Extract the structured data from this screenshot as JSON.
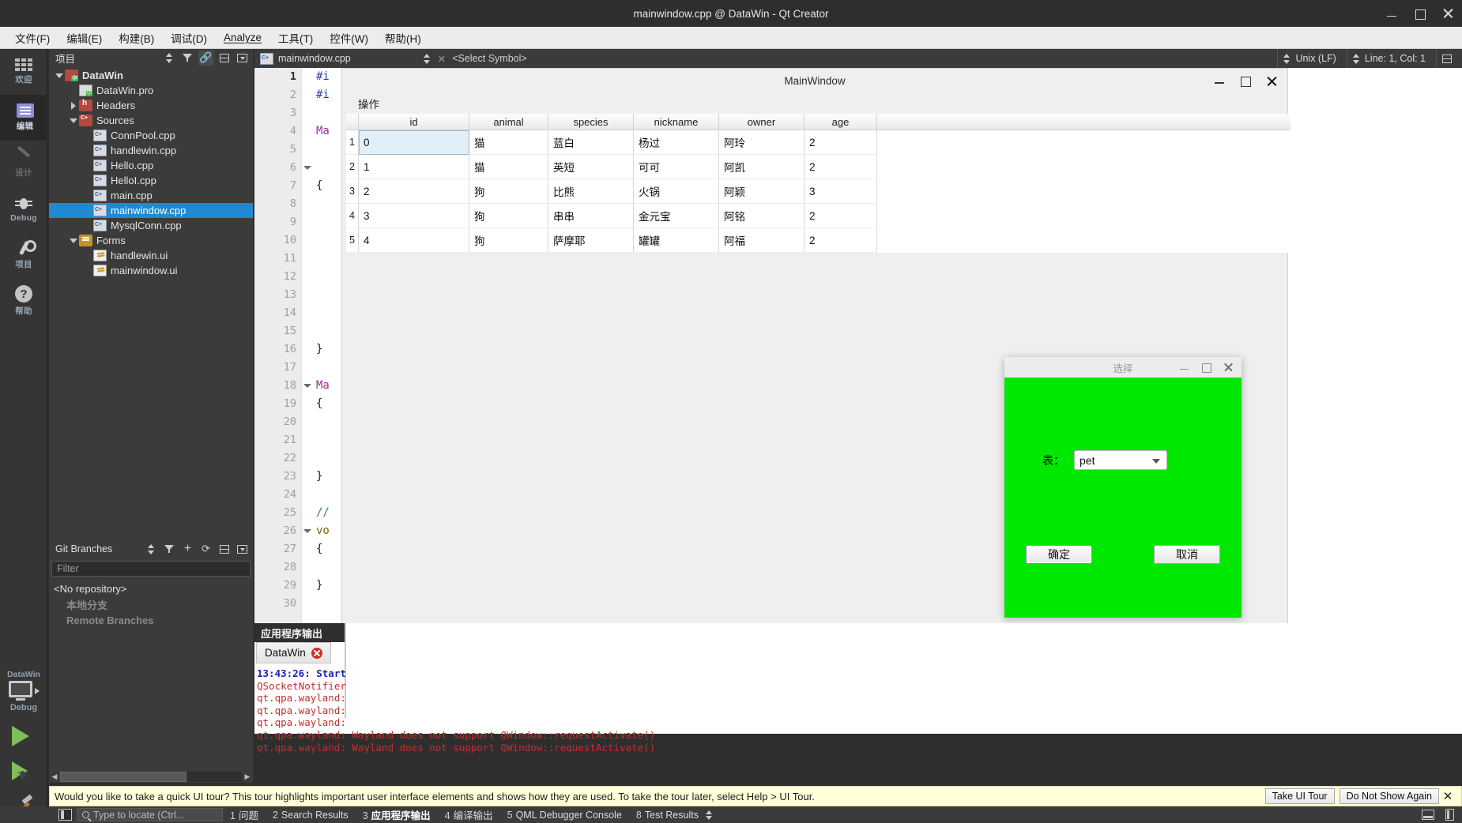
{
  "window": {
    "title": "mainwindow.cpp @ DataWin - Qt Creator",
    "controls": {
      "minimize": "—",
      "maximize": "□",
      "close": "✕"
    }
  },
  "menubar": {
    "items": [
      {
        "label": "文件(F)"
      },
      {
        "label": "编辑(E)"
      },
      {
        "label": "构建(B)"
      },
      {
        "label": "调试(D)"
      },
      {
        "label": "Analyze"
      },
      {
        "label": "工具(T)"
      },
      {
        "label": "控件(W)"
      },
      {
        "label": "帮助(H)"
      }
    ]
  },
  "modebar": {
    "items": [
      {
        "label": "欢迎",
        "icon": "grid-icon"
      },
      {
        "label": "编辑",
        "icon": "edit-icon"
      },
      {
        "label": "设计",
        "icon": "pen-icon"
      },
      {
        "label": "Debug",
        "icon": "bug-icon"
      },
      {
        "label": "项目",
        "icon": "wrench-icon"
      },
      {
        "label": "帮助",
        "icon": "question-icon"
      }
    ],
    "kit": {
      "name": "DataWin",
      "config": "Debug"
    }
  },
  "project_dock": {
    "title": "项目",
    "tree": [
      {
        "label": "DataWin",
        "depth": 0,
        "icon": "qt-project-icon",
        "twisty": "down",
        "bold": true,
        "selected": false
      },
      {
        "label": "DataWin.pro",
        "depth": 1,
        "icon": "pro-file-icon",
        "twisty": "none",
        "bold": false,
        "selected": false
      },
      {
        "label": "Headers",
        "depth": 1,
        "icon": "headers-icon",
        "twisty": "right",
        "bold": false,
        "selected": false
      },
      {
        "label": "Sources",
        "depth": 1,
        "icon": "sources-icon",
        "twisty": "down",
        "bold": false,
        "selected": false
      },
      {
        "label": "ConnPool.cpp",
        "depth": 2,
        "icon": "cpp-file-icon",
        "twisty": "none",
        "bold": false,
        "selected": false
      },
      {
        "label": "handlewin.cpp",
        "depth": 2,
        "icon": "cpp-file-icon",
        "twisty": "none",
        "bold": false,
        "selected": false
      },
      {
        "label": "Hello.cpp",
        "depth": 2,
        "icon": "cpp-file-icon",
        "twisty": "none",
        "bold": false,
        "selected": false
      },
      {
        "label": "HelloI.cpp",
        "depth": 2,
        "icon": "cpp-file-icon",
        "twisty": "none",
        "bold": false,
        "selected": false
      },
      {
        "label": "main.cpp",
        "depth": 2,
        "icon": "cpp-file-icon",
        "twisty": "none",
        "bold": false,
        "selected": false
      },
      {
        "label": "mainwindow.cpp",
        "depth": 2,
        "icon": "cpp-file-icon",
        "twisty": "none",
        "bold": false,
        "selected": true
      },
      {
        "label": "MysqlConn.cpp",
        "depth": 2,
        "icon": "cpp-file-icon",
        "twisty": "none",
        "bold": false,
        "selected": false
      },
      {
        "label": "Forms",
        "depth": 1,
        "icon": "forms-icon",
        "twisty": "down",
        "bold": false,
        "selected": false
      },
      {
        "label": "handlewin.ui",
        "depth": 2,
        "icon": "ui-file-icon",
        "twisty": "none",
        "bold": false,
        "selected": false
      },
      {
        "label": "mainwindow.ui",
        "depth": 2,
        "icon": "ui-file-icon",
        "twisty": "none",
        "bold": false,
        "selected": false
      }
    ]
  },
  "git_dock": {
    "title": "Git Branches",
    "filter_placeholder": "Filter",
    "rows": [
      {
        "label": "<No repository>",
        "dim": false
      },
      {
        "label": "本地分支",
        "dim": true
      },
      {
        "label": "Remote Branches",
        "dim": true
      }
    ]
  },
  "editor": {
    "tab_label": "mainwindow.cpp",
    "close_glyph": "✕",
    "symbol_placeholder": "<Select Symbol>",
    "line_ending": "Unix (LF)",
    "cursor_position": "Line: 1, Col: 1",
    "lines": [
      {
        "n": "1",
        "text": "#i",
        "cls": "c-pre",
        "fold": false
      },
      {
        "n": "2",
        "text": "#i",
        "cls": "c-pre",
        "fold": false
      },
      {
        "n": "3",
        "text": "",
        "cls": "",
        "fold": false
      },
      {
        "n": "4",
        "text": "Ma",
        "cls": "c-type",
        "fold": false
      },
      {
        "n": "5",
        "text": "",
        "cls": "",
        "fold": false
      },
      {
        "n": "6",
        "text": "",
        "cls": "",
        "fold": true
      },
      {
        "n": "7",
        "text": "{",
        "cls": "c-brace",
        "fold": false
      },
      {
        "n": "8",
        "text": "",
        "cls": "",
        "fold": false
      },
      {
        "n": "9",
        "text": "",
        "cls": "",
        "fold": false
      },
      {
        "n": "10",
        "text": "",
        "cls": "",
        "fold": false
      },
      {
        "n": "11",
        "text": "",
        "cls": "",
        "fold": false
      },
      {
        "n": "12",
        "text": "",
        "cls": "",
        "fold": false
      },
      {
        "n": "13",
        "text": "",
        "cls": "",
        "fold": false
      },
      {
        "n": "14",
        "text": "",
        "cls": "",
        "fold": false
      },
      {
        "n": "15",
        "text": "",
        "cls": "",
        "fold": false
      },
      {
        "n": "16",
        "text": "}",
        "cls": "c-brace",
        "fold": false
      },
      {
        "n": "17",
        "text": "",
        "cls": "",
        "fold": false
      },
      {
        "n": "18",
        "text": "Ma",
        "cls": "c-type",
        "fold": true
      },
      {
        "n": "19",
        "text": "{",
        "cls": "c-brace",
        "fold": false
      },
      {
        "n": "20",
        "text": "",
        "cls": "",
        "fold": false
      },
      {
        "n": "21",
        "text": "",
        "cls": "",
        "fold": false
      },
      {
        "n": "22",
        "text": "",
        "cls": "",
        "fold": false
      },
      {
        "n": "23",
        "text": "}",
        "cls": "c-brace",
        "fold": false
      },
      {
        "n": "24",
        "text": "",
        "cls": "",
        "fold": false
      },
      {
        "n": "25",
        "text": "//",
        "cls": "c-com",
        "fold": false
      },
      {
        "n": "26",
        "text": "vo",
        "cls": "c-kw",
        "fold": true
      },
      {
        "n": "27",
        "text": "{",
        "cls": "c-brace",
        "fold": false
      },
      {
        "n": "28",
        "text": "",
        "cls": "",
        "fold": false
      },
      {
        "n": "29",
        "text": "}",
        "cls": "c-brace",
        "fold": false
      },
      {
        "n": "30",
        "text": "",
        "cls": "",
        "fold": false
      }
    ]
  },
  "app_window": {
    "title": "MainWindow",
    "menu": [
      "操作"
    ],
    "table": {
      "columns": [
        "id",
        "animal",
        "species",
        "nickname",
        "owner",
        "age"
      ],
      "row_headers": [
        "1",
        "2",
        "3",
        "4",
        "5"
      ],
      "rows": [
        [
          "0",
          "猫",
          "蓝白",
          "杨过",
          "阿玲",
          "2"
        ],
        [
          "1",
          "猫",
          "英短",
          "可可",
          "阿凯",
          "2"
        ],
        [
          "2",
          "狗",
          "比熊",
          "火锅",
          "阿颖",
          "3"
        ],
        [
          "3",
          "狗",
          "串串",
          "金元宝",
          "阿铭",
          "2"
        ],
        [
          "4",
          "狗",
          "萨摩耶",
          "罐罐",
          "阿福",
          "2"
        ]
      ],
      "selected_cell": {
        "row": 0,
        "col": 0
      }
    }
  },
  "dialog": {
    "title": "选择",
    "background_color": "#00e800",
    "field_label": "表：",
    "combo_value": "pet",
    "ok_label": "确定",
    "cancel_label": "取消"
  },
  "output_pane": {
    "title": "应用程序输出",
    "tab_label": "DataWin",
    "lines": [
      {
        "text": "13:43:26: Start",
        "style": "blue"
      },
      {
        "text": "QSocketNotifier",
        "style": "red"
      },
      {
        "text": "qt.qpa.wayland:",
        "style": "red"
      },
      {
        "text": "qt.qpa.wayland:",
        "style": "red"
      },
      {
        "text": "qt.qpa.wayland:",
        "style": "red"
      },
      {
        "text": "qt.qpa.wayland: Wayland does not support QWindow::requestActivate()",
        "style": "red"
      },
      {
        "text": "qt.qpa.wayland: Wayland does not support QWindow::requestActivate()",
        "style": "red"
      }
    ]
  },
  "banner": {
    "message": "Would you like to take a quick UI tour? This tour highlights important user interface elements and shows how they are used. To take the tour later, select Help > UI Tour.",
    "take_tour": "Take UI Tour",
    "dismiss": "Do Not Show Again",
    "close": "✕"
  },
  "statusbar": {
    "locator_placeholder": "Type to locate (Ctrl...",
    "items": [
      {
        "num": "1",
        "label": "问题",
        "active": false
      },
      {
        "num": "2",
        "label": "Search Results",
        "active": false
      },
      {
        "num": "3",
        "label": "应用程序输出",
        "active": true
      },
      {
        "num": "4",
        "label": "编译输出",
        "active": false
      },
      {
        "num": "5",
        "label": "QML Debugger Console",
        "active": false
      },
      {
        "num": "8",
        "label": "Test Results",
        "active": false
      }
    ]
  },
  "colors": {
    "chrome_dark": "#2e2e2e",
    "dock_bg": "#3b3b3b",
    "selection_blue": "#1f8ad2",
    "dialog_green": "#00e800",
    "banner_yellow": "#ffffd9"
  }
}
